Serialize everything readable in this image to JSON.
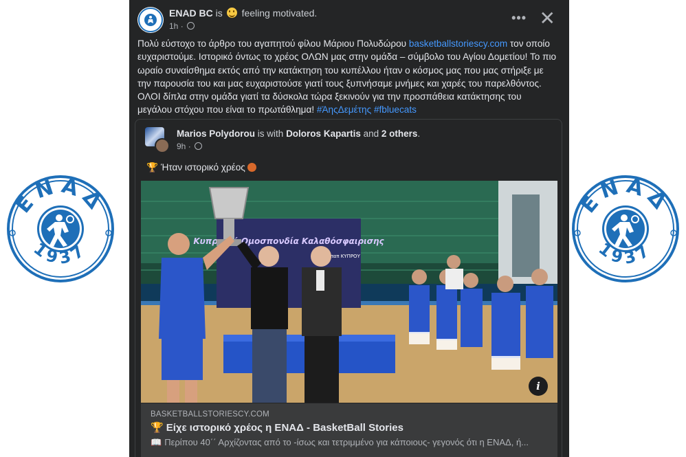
{
  "colors": {
    "logo_blue": "#1e6fb8",
    "link_blue": "#4599ff",
    "card_bg": "#242526"
  },
  "logo": {
    "word": "ΕΝΑΔ",
    "year": "1937"
  },
  "post": {
    "author": "ENAD BC",
    "is_text": "is",
    "feeling_icon": "smiling-face-icon",
    "feeling": "feeling motivated.",
    "time": "1h",
    "more_icon": "more-dots-icon",
    "close_icon": "close-icon",
    "text_part1": "Πολύ εύστοχο το άρθρο του αγαπητού φίλου Μάριου Πολυδώρου",
    "text_link": "basketballstoriescy.com",
    "text_part2": "τον οποίο ευχαριστούμε.  Ιστορικό όντως το χρέος ΟΛΩΝ μας στην ομάδα – σύμβολο του Αγίου Δομετίου! Το πιο ωραίο συναίσθημα εκτός από την κατάκτηση του κυπέλλου ήταν ο κόσμος μας που μας στήριξε με την παρουσία του και μας ευχαριστούσε γιατί τους ξυπνήσαμε μνήμες και χαρές του παρελθόντος. ΟΛΟΙ δίπλα στην ομάδα γιατί τα δύσκολα τώρα ξεκινούν για την προσπάθεια κατάκτησης του μεγάλου στόχου που είναι το πρωτάθλημα!",
    "hashtag1": "#ΆηςΔεμέτης",
    "hashtag2": "#fbluecats"
  },
  "shared": {
    "author": "Marios Polydorou",
    "with_text": "is with",
    "tagged": "Doloros Kapartis",
    "and_text": "and",
    "others": "2 others",
    "time": "9h",
    "text": "Ήταν ιστορικό χρέος",
    "photo_banner": "Κυπριακή Ομοσπονδία Καλαθόσφαιρισης",
    "photo_sponsor": "οπαπ ΚΥΠΡΟΥ"
  },
  "link_card": {
    "domain": "BASKETBALLSTORIESCY.COM",
    "title": "Είχε ιστορικό χρέος η ΕΝΑΔ - BasketBall Stories",
    "description": "Περίπου 40΄΄ Αρχίζοντας από το -ίσως και τετριμμένο για κάποιους- γεγονός ότι η ΕΝΑΔ, ή..."
  }
}
